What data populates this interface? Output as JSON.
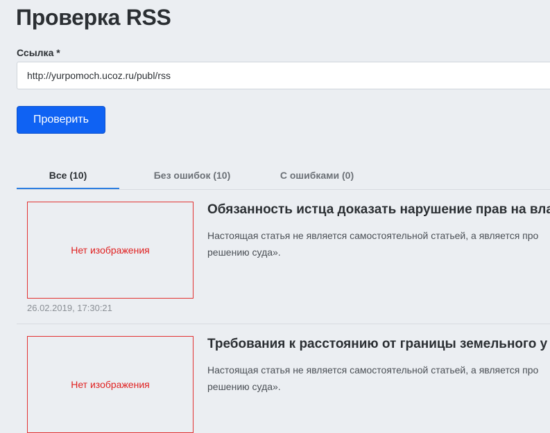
{
  "page": {
    "title": "Проверка RSS"
  },
  "form": {
    "link_label": "Ссылка *",
    "link_value": "http://yurpomoch.ucoz.ru/publ/rss",
    "check_button": "Проверить"
  },
  "tabs": [
    {
      "label": "Все (10)",
      "active": true
    },
    {
      "label": "Без ошибок (10)",
      "active": false
    },
    {
      "label": "С ошибками (0)",
      "active": false
    }
  ],
  "items": [
    {
      "image_placeholder": "Нет изображения",
      "title": "Обязанность истца доказать нарушение прав на вла",
      "desc_line1": "Настоящая статья не является самостоятельной статьей, а является про",
      "desc_line2": "решению суда».",
      "date": "26.02.2019, 17:30:21"
    },
    {
      "image_placeholder": "Нет изображения",
      "title": "Требования к расстоянию от границы земельного у",
      "desc_line1": "Настоящая статья не является самостоятельной статьей, а является про",
      "desc_line2": "решению суда»."
    }
  ]
}
